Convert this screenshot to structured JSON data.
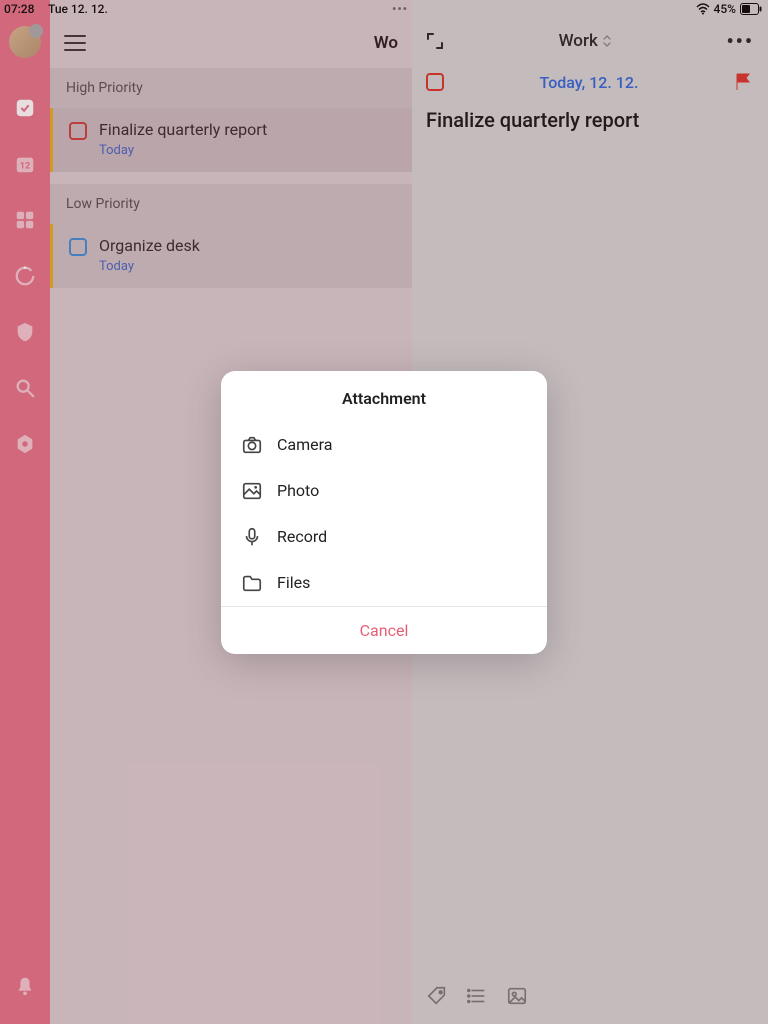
{
  "status": {
    "time": "07:28",
    "date": "Tue 12. 12.",
    "battery": "45%"
  },
  "sidebar": {
    "items": [
      "tasks",
      "calendar",
      "grid",
      "focus",
      "pomo",
      "search",
      "settings"
    ]
  },
  "list": {
    "title": "Wo",
    "sections": [
      {
        "header": "High Priority",
        "tasks": [
          {
            "title": "Finalize quarterly report",
            "sub": "Today",
            "priority": "high"
          }
        ]
      },
      {
        "header": "Low Priority",
        "tasks": [
          {
            "title": "Organize desk",
            "sub": "Today",
            "priority": "low"
          }
        ]
      }
    ]
  },
  "detail": {
    "list_name": "Work",
    "date": "Today, 12. 12.",
    "title": "Finalize quarterly report"
  },
  "modal": {
    "title": "Attachment",
    "items": [
      {
        "key": "camera",
        "label": "Camera"
      },
      {
        "key": "photo",
        "label": "Photo"
      },
      {
        "key": "record",
        "label": "Record"
      },
      {
        "key": "files",
        "label": "Files"
      }
    ],
    "cancel": "Cancel"
  }
}
